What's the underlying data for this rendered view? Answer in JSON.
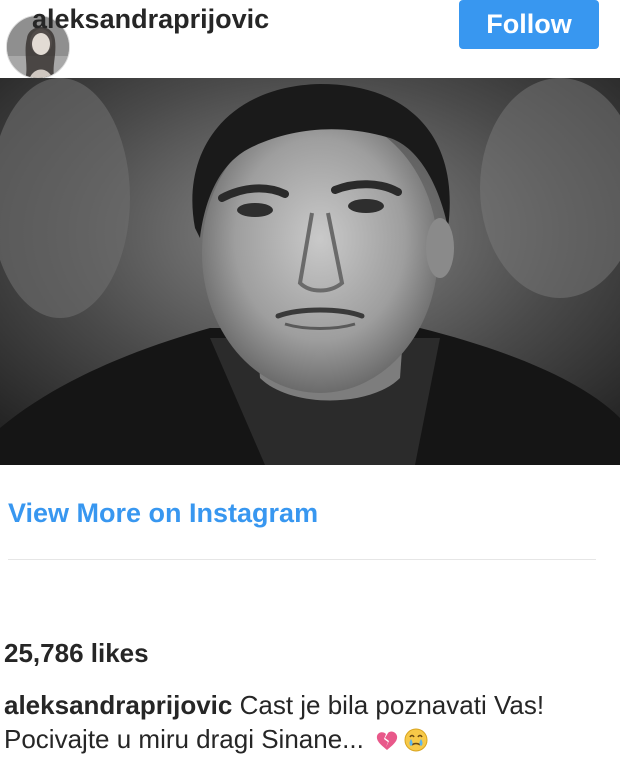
{
  "header": {
    "username": "aleksandraprijovic",
    "follow_label": "Follow"
  },
  "post": {
    "image_icon": "photo-portrait-grayscale",
    "view_more_label": "View More on Instagram",
    "likes_text": "25,786 likes",
    "caption_username": "aleksandraprijovic",
    "caption_text": "Cast je bila poznavati Vas! Pocivajte u miru dragi Sinane...",
    "caption_emojis": [
      "broken-heart-icon",
      "crying-face-icon"
    ]
  },
  "colors": {
    "accent": "#3897f0",
    "text": "#262626",
    "divider": "#e6e6e6"
  }
}
